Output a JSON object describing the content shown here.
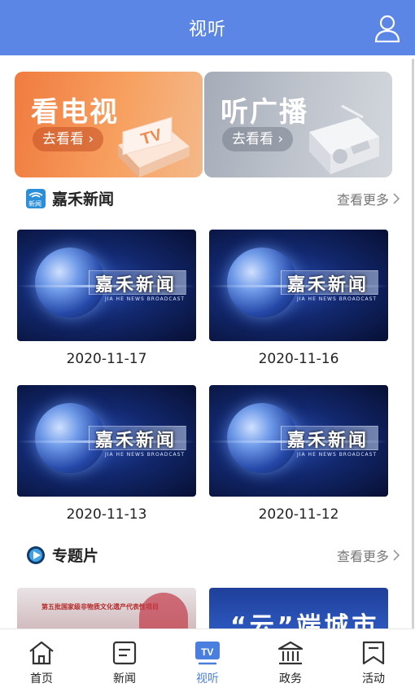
{
  "header": {
    "title": "视听"
  },
  "banners": [
    {
      "title": "看电视",
      "button": "去看看 ›",
      "art_text": "TV"
    },
    {
      "title": "听广播",
      "button": "去看看 ›"
    }
  ],
  "news_section": {
    "icon_text": "新闻",
    "title": "嘉禾新闻",
    "more": "查看更多",
    "items": [
      {
        "title_text": "嘉禾新闻",
        "subtitle": "JIA HE NEWS BROADCAST",
        "date": "2020-11-17"
      },
      {
        "title_text": "嘉禾新闻",
        "subtitle": "JIA HE NEWS BROADCAST",
        "date": "2020-11-16"
      },
      {
        "title_text": "嘉禾新闻",
        "subtitle": "JIA HE NEWS BROADCAST",
        "date": "2020-11-13"
      },
      {
        "title_text": "嘉禾新闻",
        "subtitle": "JIA HE NEWS BROADCAST",
        "date": "2020-11-12"
      }
    ]
  },
  "special_section": {
    "title": "专题片",
    "more": "查看更多",
    "items": [
      {
        "thumb_text": "第五批国家级非物质文化遗产代表性项目"
      },
      {
        "thumb_text": "“云”端城市"
      }
    ]
  },
  "tabbar": {
    "items": [
      {
        "label": "首页",
        "icon": "home-icon",
        "active": false
      },
      {
        "label": "新闻",
        "icon": "news-icon",
        "active": false
      },
      {
        "label": "视听",
        "icon": "tv-icon",
        "active": true
      },
      {
        "label": "政务",
        "icon": "government-icon",
        "active": false
      },
      {
        "label": "活动",
        "icon": "activity-icon",
        "active": false
      }
    ]
  },
  "colors": {
    "header": "#5b86e5",
    "tv_banner": "#f07b3f",
    "radio_banner": "#a5acb8",
    "active_tab": "#4a7fe0"
  }
}
